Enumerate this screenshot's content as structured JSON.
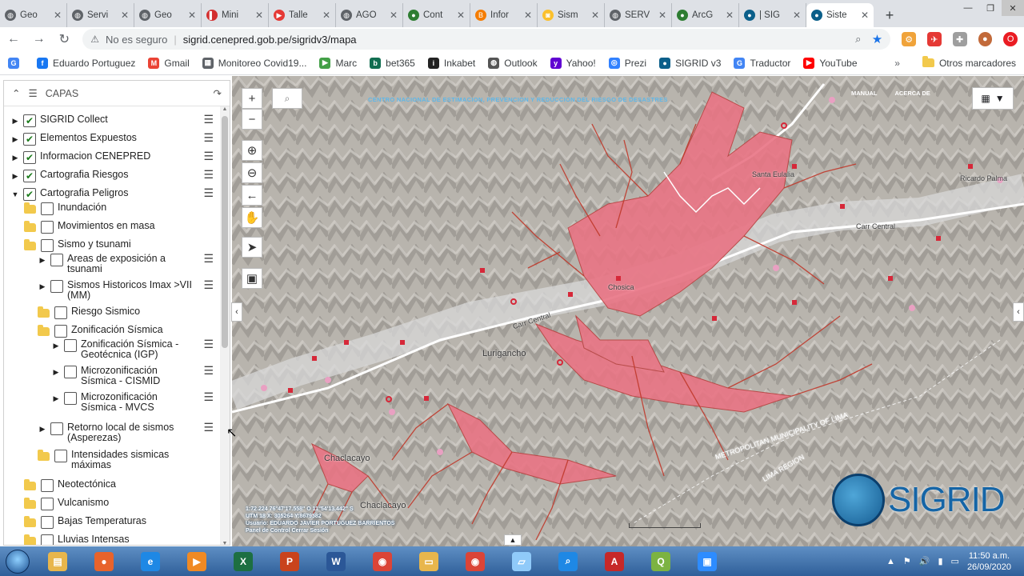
{
  "tabs": [
    {
      "label": "Geo",
      "color": "#5f6368",
      "glyph": "◍"
    },
    {
      "label": "Servi",
      "color": "#5f6368",
      "glyph": "◍"
    },
    {
      "label": "Geo",
      "color": "#5f6368",
      "glyph": "◍"
    },
    {
      "label": "Mini",
      "color": "#d32f2f",
      "glyph": "▌"
    },
    {
      "label": "Talle",
      "color": "#e53935",
      "glyph": "▶"
    },
    {
      "label": "AGO",
      "color": "#5f6368",
      "glyph": "◍"
    },
    {
      "label": "Cont",
      "color": "#2e7d32",
      "glyph": "●"
    },
    {
      "label": "Infor",
      "color": "#f57c00",
      "glyph": "B"
    },
    {
      "label": "Sism",
      "color": "#fbc02d",
      "glyph": "◙"
    },
    {
      "label": "SERV",
      "color": "#5f6368",
      "glyph": "◍"
    },
    {
      "label": "ArcG",
      "color": "#2e7d32",
      "glyph": "●"
    },
    {
      "label": "| SIG",
      "color": "#0b5f8a",
      "glyph": "●"
    },
    {
      "label": "Siste",
      "color": "#0b5f8a",
      "glyph": "●"
    }
  ],
  "address": {
    "warning": "No es seguro",
    "url": "sigrid.cenepred.gob.pe/sigridv3/mapa"
  },
  "bookmarks": [
    {
      "label": "",
      "color": "#4285f4",
      "glyph": "G"
    },
    {
      "label": "Eduardo Portuguez",
      "color": "#1877f2",
      "glyph": "f"
    },
    {
      "label": "Gmail",
      "color": "#ea4335",
      "glyph": "M"
    },
    {
      "label": "Monitoreo Covid19...",
      "color": "#5f6368",
      "glyph": "▦"
    },
    {
      "label": "Marc",
      "color": "#43a047",
      "glyph": "▶"
    },
    {
      "label": "bet365",
      "color": "#126e51",
      "glyph": "b"
    },
    {
      "label": "Inkabet",
      "color": "#222",
      "glyph": "i"
    },
    {
      "label": "Outlook",
      "color": "#555",
      "glyph": "◍"
    },
    {
      "label": "Yahoo!",
      "color": "#6001d2",
      "glyph": "y"
    },
    {
      "label": "Prezi",
      "color": "#3181ff",
      "glyph": "◎"
    },
    {
      "label": "SIGRID v3",
      "color": "#0b5f8a",
      "glyph": "●"
    },
    {
      "label": "Traductor",
      "color": "#4285f4",
      "glyph": "G"
    },
    {
      "label": "YouTube",
      "color": "#ff0000",
      "glyph": "▶"
    }
  ],
  "bookmarks_more": "»",
  "bookmarks_other": "Otros marcadores",
  "panel": {
    "title": "CAPAS",
    "rows": [
      {
        "label": "SIGRID Collect",
        "indent": 0,
        "arrow": "▶",
        "type": "checked",
        "menu": true
      },
      {
        "label": "Elementos Expuestos",
        "indent": 0,
        "arrow": "▶",
        "type": "checked",
        "menu": true
      },
      {
        "label": "Informacion CENEPRED",
        "indent": 0,
        "arrow": "▶",
        "type": "checked",
        "menu": true
      },
      {
        "label": "Cartografia Riesgos",
        "indent": 0,
        "arrow": "▶",
        "type": "checked",
        "menu": true
      },
      {
        "label": "Cartografia Peligros",
        "indent": 0,
        "arrow": "▼",
        "type": "checked",
        "menu": true
      },
      {
        "label": "Inundación",
        "indent": 1,
        "folder": true,
        "type": "unchecked"
      },
      {
        "label": "Movimientos en masa",
        "indent": 1,
        "folder": true,
        "type": "unchecked"
      },
      {
        "label": "Sismo y tsunami",
        "indent": 1,
        "folder": true,
        "type": "unchecked"
      },
      {
        "label": "Areas de exposición a tsunami",
        "indent": 2,
        "arrow": "▶",
        "type": "unchecked",
        "menu": true
      },
      {
        "label": "Sismos Historicos Imax >VII (MM)",
        "indent": 2,
        "arrow": "▶",
        "type": "unchecked",
        "menu": true
      },
      {
        "label": "Riesgo Sismico",
        "indent": 2,
        "folder": true,
        "type": "unchecked"
      },
      {
        "label": "Zonificación Sísmica",
        "indent": 2,
        "folder": true,
        "type": "unchecked"
      },
      {
        "label": "Zonificación Sísmica - Geotécnica (IGP)",
        "indent": 3,
        "arrow": "▶",
        "type": "unchecked",
        "menu": true
      },
      {
        "label": "Microzonificación Sísmica - CISMID",
        "indent": 3,
        "arrow": "▶",
        "type": "unchecked",
        "menu": true
      },
      {
        "label": "Microzonificación Sísmica - MVCS",
        "indent": 3,
        "arrow": "▶",
        "type": "unchecked",
        "menu": true
      },
      {
        "label": "Retorno local de sismos (Asperezas)",
        "indent": 2,
        "arrow": "▶",
        "type": "unchecked",
        "menu": true
      },
      {
        "label": "Intensidades sismicas máximas",
        "indent": 2,
        "folder": true,
        "type": "unchecked"
      },
      {
        "label": "Neotectónica",
        "indent": 1,
        "folder": true,
        "type": "unchecked"
      },
      {
        "label": "Vulcanismo",
        "indent": 1,
        "folder": true,
        "type": "unchecked"
      },
      {
        "label": "Bajas Temperaturas",
        "indent": 1,
        "folder": true,
        "type": "unchecked"
      },
      {
        "label": "Lluvias Intensas",
        "indent": 1,
        "folder": true,
        "type": "unchecked"
      }
    ]
  },
  "map": {
    "title": "CENTRO NACIONAL DE ESTIMACION, PREVENCION Y REDUCCION DEL RIESGO DE DESASTRES",
    "links": [
      "MANUAL",
      "ACERCA DE"
    ],
    "labels": [
      {
        "text": "Santa Eulalia",
        "cls": "small"
      },
      {
        "text": "Ricardo Palma",
        "cls": "small"
      },
      {
        "text": "Carr Central",
        "cls": "small"
      },
      {
        "text": "Chosica",
        "cls": "small"
      },
      {
        "text": "Carr Central",
        "cls": "small"
      },
      {
        "text": "Lurigancho",
        "cls": ""
      },
      {
        "text": "Chaclacayo",
        "cls": ""
      },
      {
        "text": "Chaclacayo",
        "cls": ""
      },
      {
        "text": "METROPOLITAN MUNICIPALITY OF LIMA",
        "cls": "small"
      },
      {
        "text": "LIMA REGION",
        "cls": "small"
      }
    ],
    "coords": [
      "1:72.224      76°47'17.558\" O  11°54'13.442\" S",
      "UTM 18 X: 305264   Y:8679582",
      "Usuario: EDUARDO JAVIER PORTUGUEZ BARRIENTOS",
      "Panel de Control     Cerrar Sesión"
    ],
    "logo": "SIGRID",
    "hazard_color": "#e97484",
    "point_color": "#d62839"
  },
  "taskbar": {
    "apps": [
      {
        "name": "explorer",
        "color": "#e8b64c",
        "glyph": "▤"
      },
      {
        "name": "firefox",
        "color": "#e8632b",
        "glyph": "●"
      },
      {
        "name": "ie",
        "color": "#1e88e5",
        "glyph": "e"
      },
      {
        "name": "media",
        "color": "#f08a24",
        "glyph": "▶"
      },
      {
        "name": "excel",
        "color": "#1d6f42",
        "glyph": "X"
      },
      {
        "name": "powerpoint",
        "color": "#c9431c",
        "glyph": "P"
      },
      {
        "name": "word",
        "color": "#2b5797",
        "glyph": "W"
      },
      {
        "name": "chrome",
        "color": "#db4437",
        "glyph": "◉"
      },
      {
        "name": "folder",
        "color": "#e8b64c",
        "glyph": "▭"
      },
      {
        "name": "chrome2",
        "color": "#db4437",
        "glyph": "◉"
      },
      {
        "name": "notepad",
        "color": "#90caf9",
        "glyph": "▱"
      },
      {
        "name": "search",
        "color": "#1e88e5",
        "glyph": "⌕"
      },
      {
        "name": "acrobat",
        "color": "#c62828",
        "glyph": "A"
      },
      {
        "name": "qgis",
        "color": "#7cb342",
        "glyph": "Q"
      },
      {
        "name": "zoom",
        "color": "#2d8cff",
        "glyph": "▣"
      }
    ],
    "time": "11:50 a.m.",
    "date": "26/09/2020"
  }
}
